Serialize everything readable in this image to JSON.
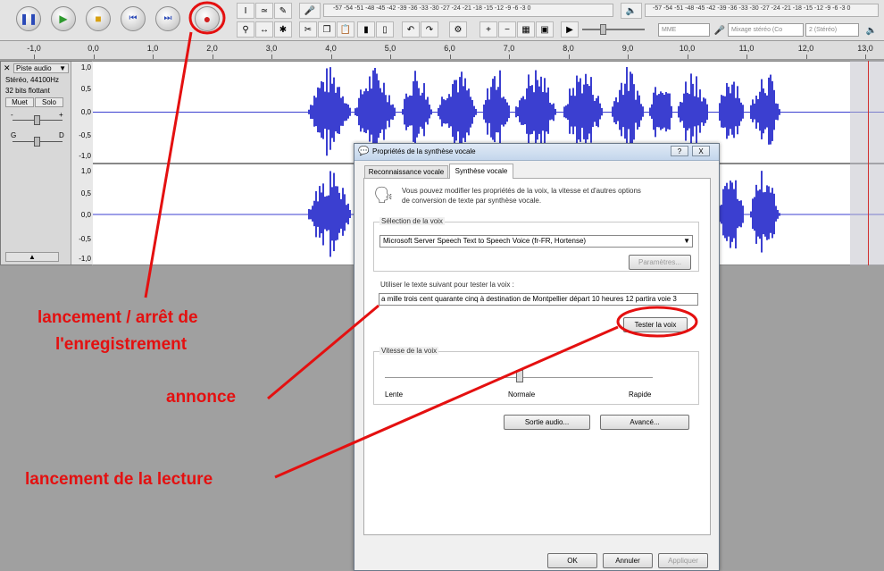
{
  "ruler": {
    "labels": [
      "-1,0",
      "0,0",
      "1,0",
      "2,0",
      "3,0",
      "4,0",
      "5,0",
      "6,0",
      "7,0",
      "8,0",
      "9,0",
      "10,0",
      "11,0",
      "12,0",
      "13,0"
    ]
  },
  "meters": {
    "record_scale": "-57 -54 -51 -48 -45 -42 -39 -36 -33 -30 -27 -24 -21 -18 -15 -12 -9 -6 -3 0",
    "play_scale": "-57 -54 -51 -48 -45 -42 -39 -36 -33 -30 -27 -24 -21 -18 -15 -12 -9 -6 -3 0"
  },
  "mixer": {
    "host": "MME",
    "input_source": "Mixage stéréo (Co",
    "channels": "2 (Stéréo)"
  },
  "track": {
    "name": "Piste audio",
    "format_line1": "Stéréo, 44100Hz",
    "format_line2": "32 bits flottant",
    "mute_label": "Muet",
    "solo_label": "Solo",
    "gain_minus": "-",
    "gain_plus": "+",
    "pan_left": "G",
    "pan_right": "D",
    "scale": [
      "1,0",
      "0,5",
      "0,0",
      "-0,5",
      "-1,0"
    ],
    "scale2": [
      "1,0",
      "0,5",
      "0,0",
      "-0,5",
      "-1,0"
    ]
  },
  "dialog": {
    "title": "Propriétés de la synthèse vocale",
    "tab_recognition": "Reconnaissance vocale",
    "tab_synthesis": "Synthèse vocale",
    "intro": "Vous pouvez modifier les propriétés de la voix, la vitesse et d'autres options de conversion de texte par synthèse vocale.",
    "voice_group": "Sélection de la voix",
    "voice_selected": "Microsoft Server Speech Text to Speech Voice (fr-FR, Hortense)",
    "settings_button": "Paramètres...",
    "test_label": "Utiliser le texte suivant pour tester la voix :",
    "test_text": "a mille trois cent quarante cinq à destination de Montpellier départ 10 heures 12  partira voie 3",
    "test_button": "Tester la voix",
    "speed_group": "Vitesse de la voix",
    "speed_slow": "Lente",
    "speed_normal": "Normale",
    "speed_fast": "Rapide",
    "speed_value": 0.5,
    "audio_output_button": "Sortie audio...",
    "advanced_button": "Avancé...",
    "ok_button": "OK",
    "cancel_button": "Annuler",
    "apply_button": "Appliquer",
    "help_button": "?",
    "close_button": "X"
  },
  "annotations": {
    "record": "lancement / arrêt de\nl'enregistrement",
    "record_line1": "lancement / arrêt de",
    "record_line2": "l'enregistrement",
    "announce": "annonce",
    "playback": "lancement de la lecture"
  },
  "colors": {
    "annotation": "#e41010",
    "waveform": "#3b3fd0",
    "record_button": "#d02020"
  }
}
